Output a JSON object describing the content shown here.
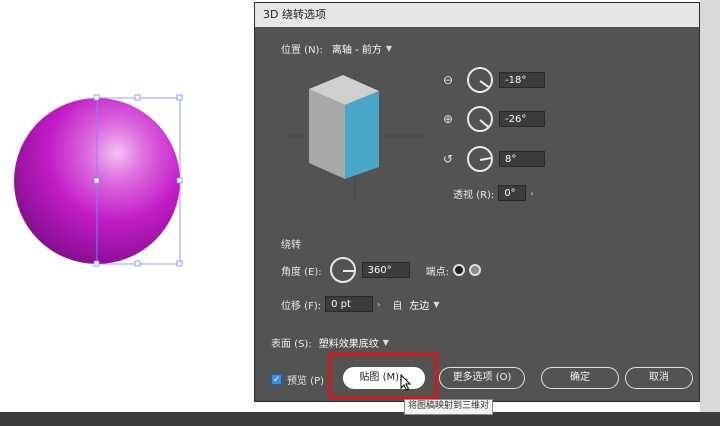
{
  "dialog": {
    "title": "3D 绕转选项",
    "position": {
      "label": "位置 (N):",
      "value": "离轴 - 前方"
    },
    "rotation": {
      "x": {
        "value": "-18°",
        "icon": "x-axis-rotate-icon"
      },
      "y": {
        "value": "-26°",
        "icon": "y-axis-rotate-icon"
      },
      "z": {
        "value": "8°",
        "icon": "z-axis-rotate-icon"
      }
    },
    "perspective": {
      "label": "透视 (R):",
      "value": "0°"
    },
    "revolve": {
      "section_label": "绕转",
      "angle": {
        "label": "角度 (E):",
        "value": "360°"
      },
      "cap": {
        "label": "端点:"
      },
      "offset": {
        "label": "位移 (F):",
        "value": "0 pt",
        "from_label": "自",
        "from_value": "左边"
      }
    },
    "surface": {
      "label": "表面 (S):",
      "value": "塑料效果底纹"
    },
    "preview": {
      "label": "预览 (P)",
      "checked": true
    },
    "buttons": {
      "map": "贴图 (M)...",
      "more_options": "更多选项 (O)",
      "ok": "确定",
      "cancel": "取消"
    },
    "tooltip": "将图稿映射到三维对"
  },
  "colors": {
    "dialog_bg": "#535353",
    "cube_front": "#4aa6c6",
    "sphere": "#c21cc7",
    "highlight": "#d21a1a"
  }
}
